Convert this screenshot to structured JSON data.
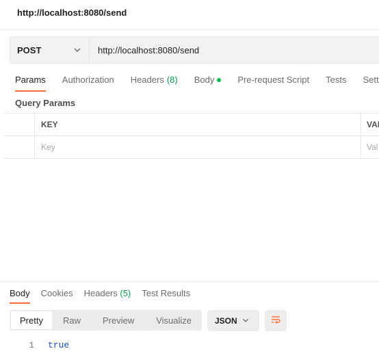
{
  "request": {
    "title": "http://localhost:8080/send",
    "method": "POST",
    "url": "http://localhost:8080/send"
  },
  "request_tabs": {
    "params": "Params",
    "authorization": "Authorization",
    "headers": "Headers",
    "headers_count": "(8)",
    "body": "Body",
    "prerequest": "Pre-request Script",
    "tests": "Tests",
    "settings": "Sett"
  },
  "query": {
    "title": "Query Params",
    "key_header": "KEY",
    "value_header": "VAL",
    "key_placeholder": "Key",
    "value_placeholder": "Val"
  },
  "response_tabs": {
    "body": "Body",
    "cookies": "Cookies",
    "headers": "Headers",
    "headers_count": "(5)",
    "test_results": "Test Results"
  },
  "view_modes": {
    "pretty": "Pretty",
    "raw": "Raw",
    "preview": "Preview",
    "visualize": "Visualize"
  },
  "format": "JSON",
  "response_body": {
    "line_number": "1",
    "content": "true"
  },
  "colors": {
    "accent": "#ff6c37",
    "count_green": "#0c9a4e",
    "body_dot": "#0cbb52",
    "code_blue": "#1a4fb8"
  },
  "icons": {
    "method_dropdown": "chevron-down-icon",
    "format_dropdown": "chevron-down-icon",
    "wrap": "wrap-lines-icon"
  }
}
